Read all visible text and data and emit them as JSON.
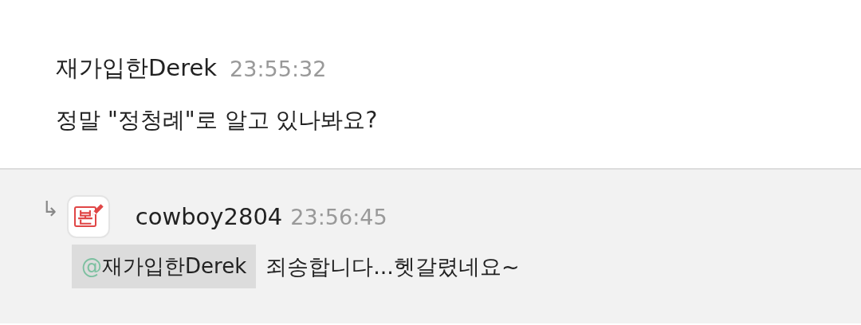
{
  "message": {
    "author": "재가입한Derek",
    "time": "23:55:32",
    "text": "정말 \"정청례\"로 알고 있나봐요?"
  },
  "reply": {
    "arrow": "↳",
    "badge": "본",
    "author": "cowboy2804",
    "time": "23:56:45",
    "mention": {
      "at": "@",
      "name": "재가입한Derek"
    },
    "text": "죄송합니다...헷갈렸네요~"
  }
}
